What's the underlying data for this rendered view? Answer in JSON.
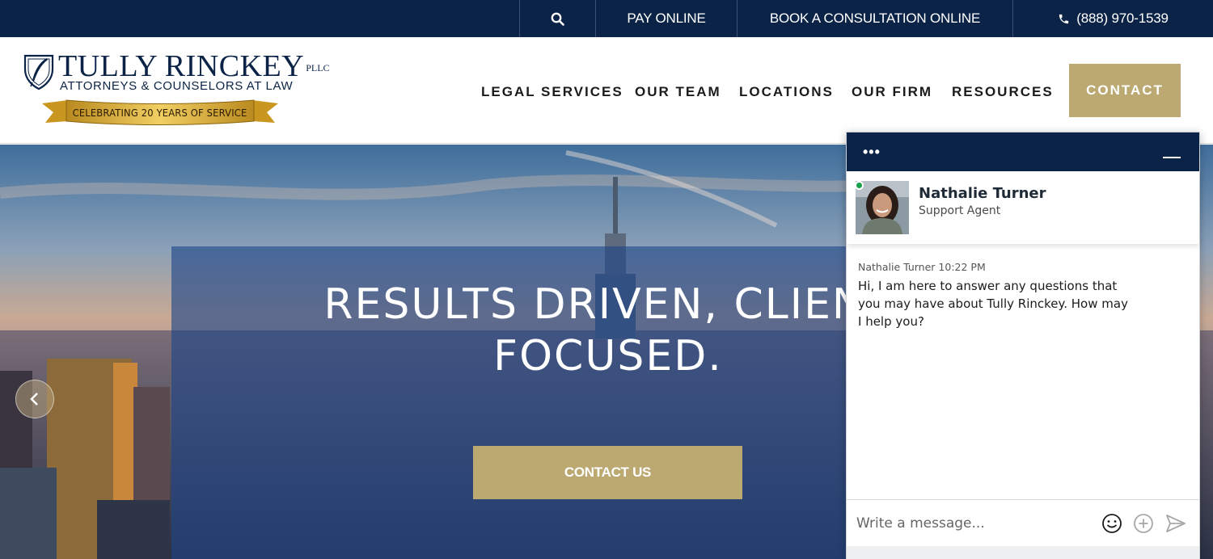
{
  "topbar": {
    "search_icon": "search-icon",
    "pay_online": "PAY ONLINE",
    "book_consultation": "BOOK A CONSULTATION ONLINE",
    "phone_icon": "phone-icon",
    "phone": "(888) 970-1539"
  },
  "logo": {
    "name": "TULLY RINCKEY",
    "suffix": "PLLC",
    "tagline": "ATTORNEYS & COUNSELORS AT LAW",
    "banner": "CELEBRATING 20 YEARS OF SERVICE"
  },
  "nav": {
    "items": [
      "LEGAL SERVICES",
      "OUR TEAM",
      "LOCATIONS",
      "OUR FIRM",
      "RESOURCES"
    ],
    "contact": "CONTACT"
  },
  "hero": {
    "title_line1": "RESULTS DRIVEN, CLIENT",
    "title_line2": "FOCUSED.",
    "cta": "CONTACT US",
    "prev_icon": "chevron-left-icon"
  },
  "chat": {
    "menu_icon": "more-dots-icon",
    "minimize_icon": "minimize-icon",
    "agent_name": "Nathalie Turner",
    "agent_role": "Support Agent",
    "message_meta": "Nathalie Turner 10:22 PM",
    "message": "Hi, I am here to answer any questions that you may have about Tully Rinckey. How may I help you?",
    "input_placeholder": "Write a message...",
    "emoji_icon": "emoji-icon",
    "attach_icon": "plus-circle-icon",
    "send_icon": "send-icon"
  },
  "colors": {
    "navy": "#0b2346",
    "gold": "#bba971",
    "hero_overlay": "#1e4687",
    "online": "#18a04a"
  }
}
